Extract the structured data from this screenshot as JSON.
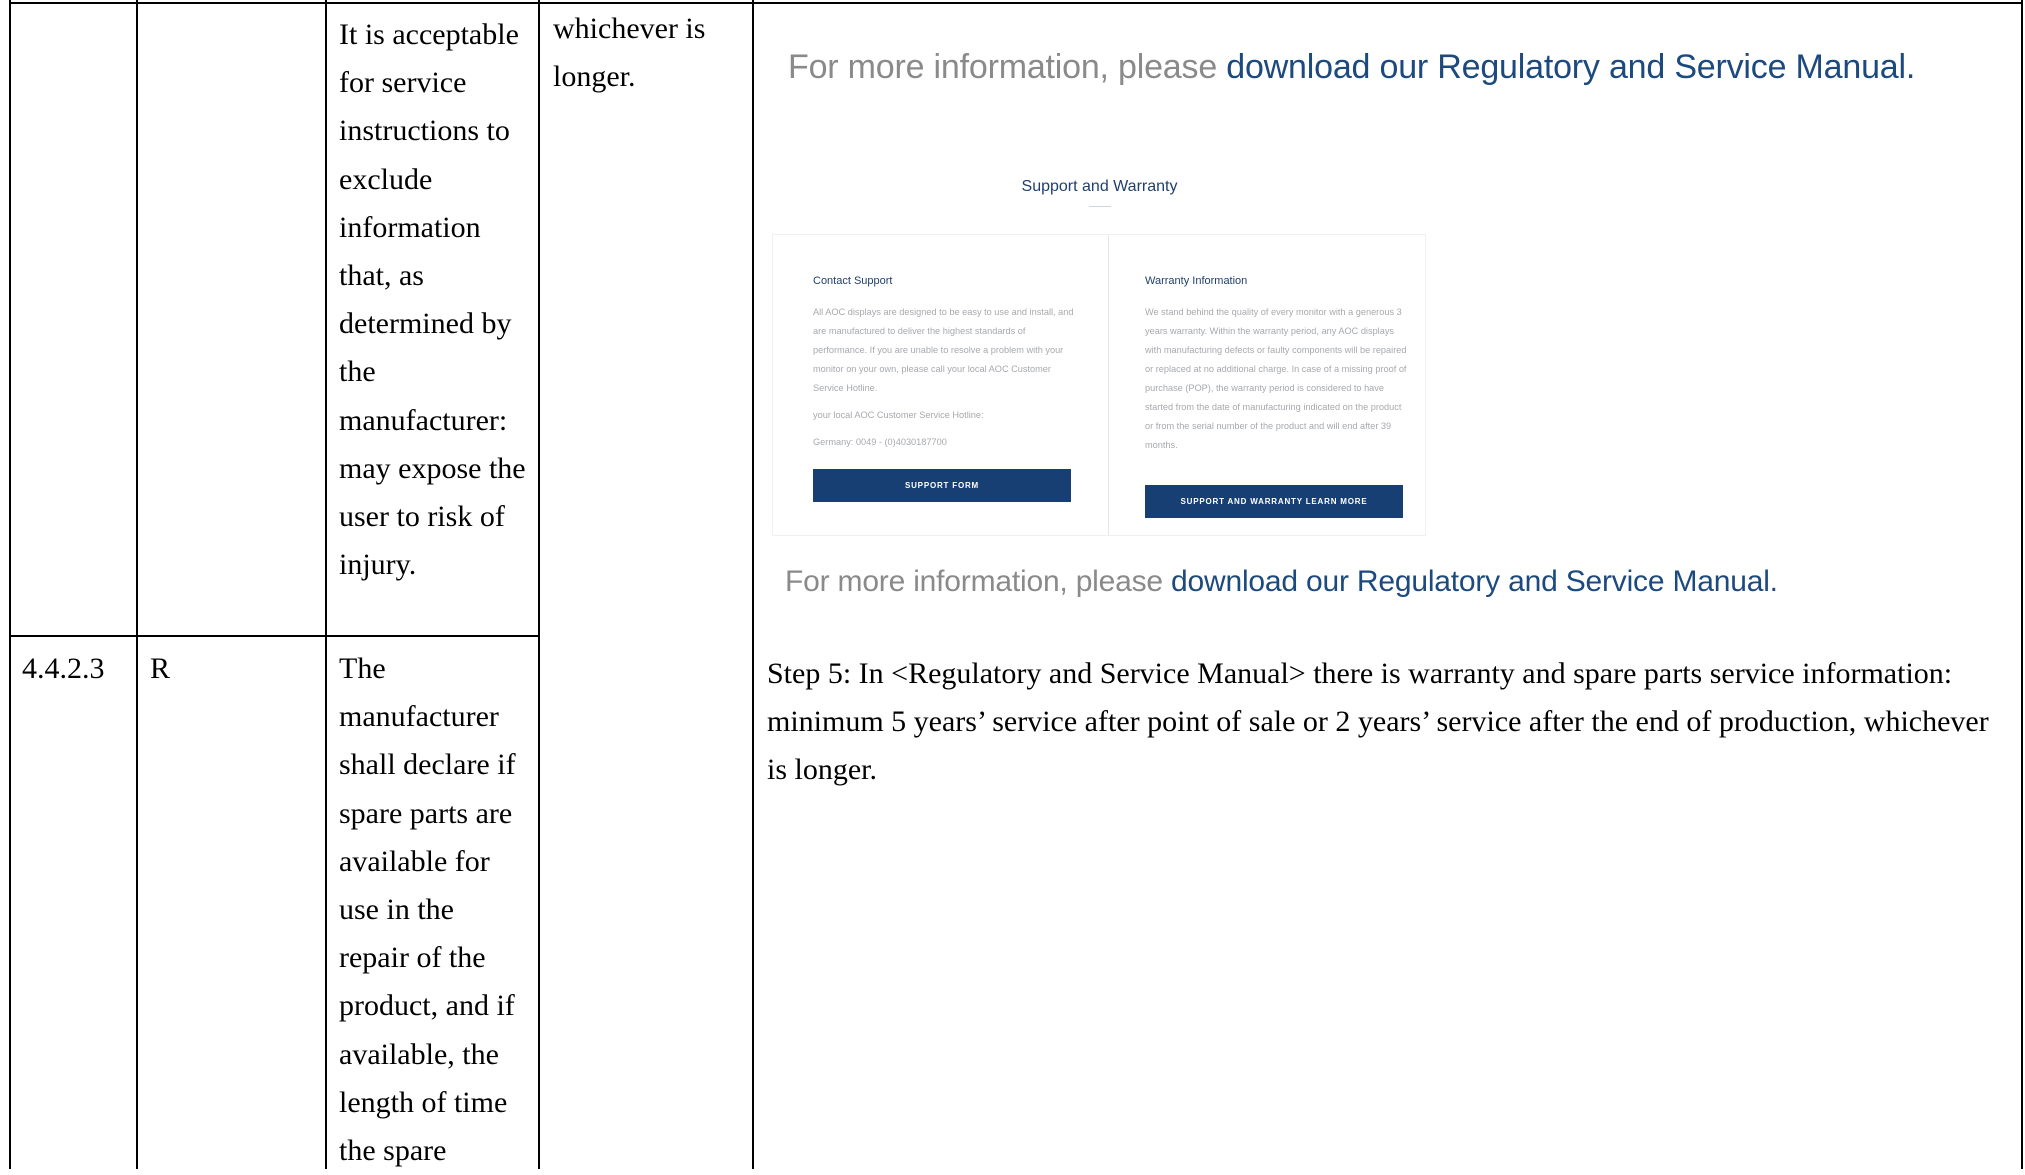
{
  "table": {
    "row1": {
      "col3_text": "It is acceptable for service instructions to exclude information that, as determined by the manufacturer: may expose the user to risk of injury.",
      "col4_text": "whichever is longer."
    },
    "row2": {
      "clause": "4.4.2.3",
      "type": "R",
      "requirement": "The manufacturer shall declare if spare parts are available for use in the repair of the product, and if available, the length of time the spare"
    }
  },
  "evidence": {
    "info_line_prefix": "For more information, please ",
    "info_line_link": "download our Regulatory and Service Manual",
    "info_line_period": ".",
    "step5_text": "Step 5: In <Regulatory and Service Manual> there is warranty and spare parts service information: minimum 5 years’ service after point of sale or 2 years’ service after the end of production, whichever is longer."
  },
  "screenshot": {
    "title": "Support and Warranty",
    "contact": {
      "title": "Contact Support",
      "body": "All AOC displays are designed to be easy to use and install, and are manufactured to deliver the highest standards of performance. If you are unable to resolve a problem with your monitor on your own, please call your local AOC Customer Service Hotline.",
      "hotline_label": "your local AOC Customer Service Hotline:",
      "hotline_number": "Germany: 0049 - (0)4030187700",
      "button": "SUPPORT FORM"
    },
    "warranty": {
      "title": "Warranty Information",
      "body": "We stand behind the quality of every monitor with a generous 3 years warranty. Within the warranty period, any AOC displays with manufacturing defects or faulty components will be repaired or replaced at no additional charge. In case of a missing proof of purchase (POP), the warranty period is considered to have started from the date of manufacturing indicated on the product or from the serial number of the product and will end after 39 months.",
      "button": "SUPPORT AND WARRANTY LEARN MORE"
    }
  },
  "colors": {
    "link": "#1d4a7e",
    "muted_text": "#8a8a8a",
    "button_bg": "#173f73"
  }
}
